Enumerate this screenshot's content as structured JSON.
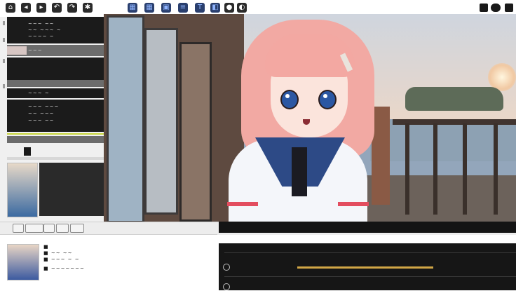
{
  "toolbar": {
    "left_buttons": [
      {
        "icon": "home-icon",
        "glyph": "⌂",
        "style": "dark"
      },
      {
        "icon": "back-icon",
        "glyph": "◂",
        "style": "dark"
      },
      {
        "icon": "forward-icon",
        "glyph": "▸",
        "style": "dark"
      },
      {
        "icon": "undo-icon",
        "glyph": "↶",
        "style": "dark"
      },
      {
        "icon": "redo-icon",
        "glyph": "↷",
        "style": "dark"
      },
      {
        "icon": "settings-icon",
        "glyph": "✱",
        "style": "dark"
      }
    ],
    "mid_buttons": [
      {
        "icon": "layout-icon",
        "glyph": "▦",
        "style": "blue"
      },
      {
        "icon": "grid-icon",
        "glyph": "▦",
        "style": "blue"
      },
      {
        "icon": "frame-icon",
        "glyph": "▣",
        "style": "blue"
      },
      {
        "icon": "list-icon",
        "glyph": "≡",
        "style": "blue"
      },
      {
        "icon": "text-icon",
        "glyph": "T",
        "style": "blue"
      },
      {
        "icon": "view-icon",
        "glyph": "◧",
        "style": "blue"
      },
      {
        "icon": "record-icon",
        "glyph": "●",
        "style": "dark"
      },
      {
        "icon": "mask-icon",
        "glyph": "◐",
        "style": "dark"
      }
    ]
  },
  "left_panel": {
    "rows": [
      {
        "lines": [
          "~~~ ~~",
          "~~ ~~~ ~",
          "~~~~ ~"
        ]
      },
      {
        "lines": [
          "~~~"
        ]
      },
      {
        "lines": [
          "~~~ ~",
          "~~ ~~"
        ]
      },
      {
        "lines": [
          "~~~ ~~~",
          "~~ ~~~",
          "~~~ ~~"
        ]
      }
    ]
  },
  "lower_left": {
    "lines": [
      "■",
      "■ ~~ ~~",
      "■ ~~~ ~ ~",
      "■ ~~~~~~~"
    ]
  },
  "colors": {
    "accent_lime": "#c7d53b",
    "timeline_clip": "#d1a646",
    "panel_dark": "#1b1b1b"
  }
}
